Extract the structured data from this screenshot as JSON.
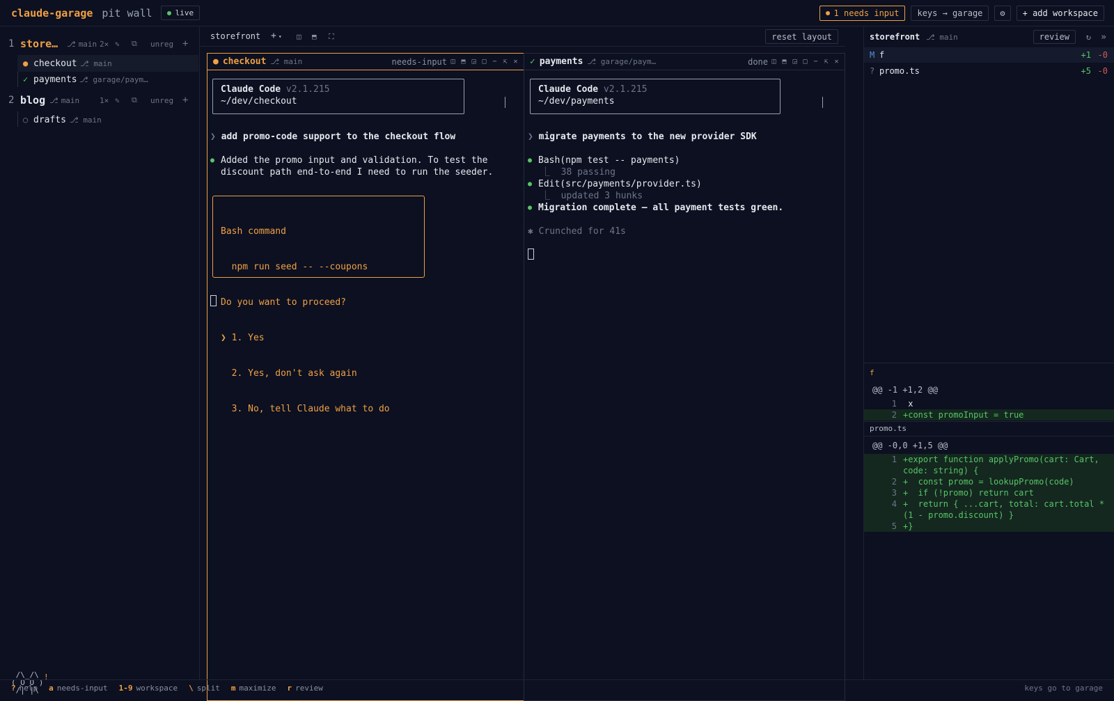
{
  "topbar": {
    "brand": "claude-garage",
    "subtitle": "pit wall",
    "live": "live",
    "needs_input": "1 needs input",
    "keys_mode": "keys → garage",
    "settings_icon": "⚙",
    "add_workspace": "+ add workspace"
  },
  "colors": {
    "accent": "#f0a045",
    "success": "#58c468",
    "background": "#0c1020",
    "removed": "#d05a5a"
  },
  "sidebar": {
    "workspaces": [
      {
        "num": "1",
        "name": "store…",
        "branch": "main",
        "count": "2×",
        "unreg": "unreg",
        "sessions": [
          {
            "name": "checkout",
            "branch": "main",
            "status": "needs-input"
          },
          {
            "name": "payments",
            "branch": "garage/paym…",
            "status": "done"
          }
        ]
      },
      {
        "num": "2",
        "name": "blog",
        "branch": "main",
        "count": "1×",
        "unreg": "unreg",
        "sessions": [
          {
            "name": "drafts",
            "branch": "main",
            "status": "idle"
          }
        ]
      }
    ],
    "mascot": " /\\_/\\\n( O_O )\n /| |\\",
    "mascot_alert": "!"
  },
  "center": {
    "workspace": "storefront",
    "add_pane": "+",
    "reset_layout": "reset layout",
    "panes": [
      {
        "title": "checkout",
        "branch": "main",
        "status": "needs-input",
        "header_title": "Claude Code",
        "version": "v2.1.215",
        "path": "~/dev/checkout",
        "prompt": "add promo-code support to the checkout flow",
        "response_1": "Added the promo input and validation. To test the",
        "response_2": "discount path end-to-end I need to run the seeder.",
        "perm": {
          "title": "Bash command",
          "command": "  npm run seed -- --coupons",
          "question": "Do you want to proceed?",
          "opt1": "❯ 1. Yes",
          "opt2": "  2. Yes, don't ask again",
          "opt3": "  3. No, tell Claude what to do"
        }
      },
      {
        "title": "payments",
        "branch": "garage/paym…",
        "status": "done",
        "header_title": "Claude Code",
        "version": "v2.1.215",
        "path": "~/dev/payments",
        "prompt": "migrate payments to the new provider SDK",
        "tool1": "Bash(npm test -- payments)",
        "tool1_result": "38 passing",
        "tool2": "Edit(src/payments/provider.ts)",
        "tool2_result": "updated 3 hunks",
        "summary": "Migration complete — all payment tests green.",
        "timing": "✱ Crunched for 41s"
      }
    ]
  },
  "review": {
    "workspace": "storefront",
    "branch": "main",
    "review_button": "review",
    "files": [
      {
        "status": "M",
        "name": "f",
        "added": "+1",
        "removed": "-0"
      },
      {
        "status": "?",
        "name": "promo.ts",
        "added": "+5",
        "removed": "-0"
      }
    ],
    "diffs": [
      {
        "file": "f",
        "hunk": "@@ -1 +1,2 @@",
        "lines": [
          {
            "n": "1",
            "text": " x",
            "type": "ctx"
          },
          {
            "n": "2",
            "text": "+const promoInput = true",
            "type": "add"
          }
        ]
      },
      {
        "file": "promo.ts",
        "hunk": "@@ -0,0 +1,5 @@",
        "lines": [
          {
            "n": "1",
            "text": "+export function applyPromo(cart: Cart, code: string) {",
            "type": "add"
          },
          {
            "n": "2",
            "text": "+  const promo = lookupPromo(code)",
            "type": "add"
          },
          {
            "n": "3",
            "text": "+  if (!promo) return cart",
            "type": "add"
          },
          {
            "n": "4",
            "text": "+  return { ...cart, total: cart.total * (1 - promo.discount) }",
            "type": "add"
          },
          {
            "n": "5",
            "text": "+}",
            "type": "add"
          }
        ]
      }
    ]
  },
  "statusbar": {
    "hints": [
      {
        "key": "?",
        "label": "help"
      },
      {
        "key": "a",
        "label": "needs-input"
      },
      {
        "key": "1-9",
        "label": "workspace"
      },
      {
        "key": "\\",
        "label": "split"
      },
      {
        "key": "m",
        "label": "maximize"
      },
      {
        "key": "r",
        "label": "review"
      }
    ],
    "right": "keys go to garage"
  }
}
